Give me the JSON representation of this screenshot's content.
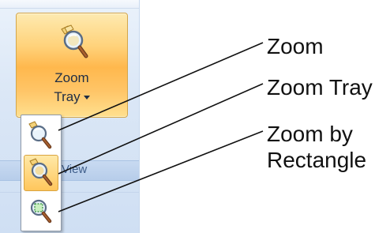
{
  "ribbon": {
    "big_button": {
      "label_line1": "Zoom",
      "label_line2": "Tray",
      "icon": "zoom-tray-icon"
    },
    "group_caption": "View",
    "group_caption_visible_fragment": "View"
  },
  "dropdown": {
    "items": [
      {
        "icon": "zoom-icon",
        "selected": false
      },
      {
        "icon": "zoom-tray-icon",
        "selected": true
      },
      {
        "icon": "zoom-by-rectangle-icon",
        "selected": false
      }
    ]
  },
  "callouts": {
    "zoom": "Zoom",
    "zoom_tray": "Zoom Tray",
    "zoom_by_rectangle_line1": "Zoom by",
    "zoom_by_rectangle_line2": "Rectangle"
  },
  "colors": {
    "button_orange": "#ffb84d",
    "ribbon_blue": "#dbe7f6",
    "caption_text": "#3f5e8b",
    "leader_line": "#111111"
  }
}
